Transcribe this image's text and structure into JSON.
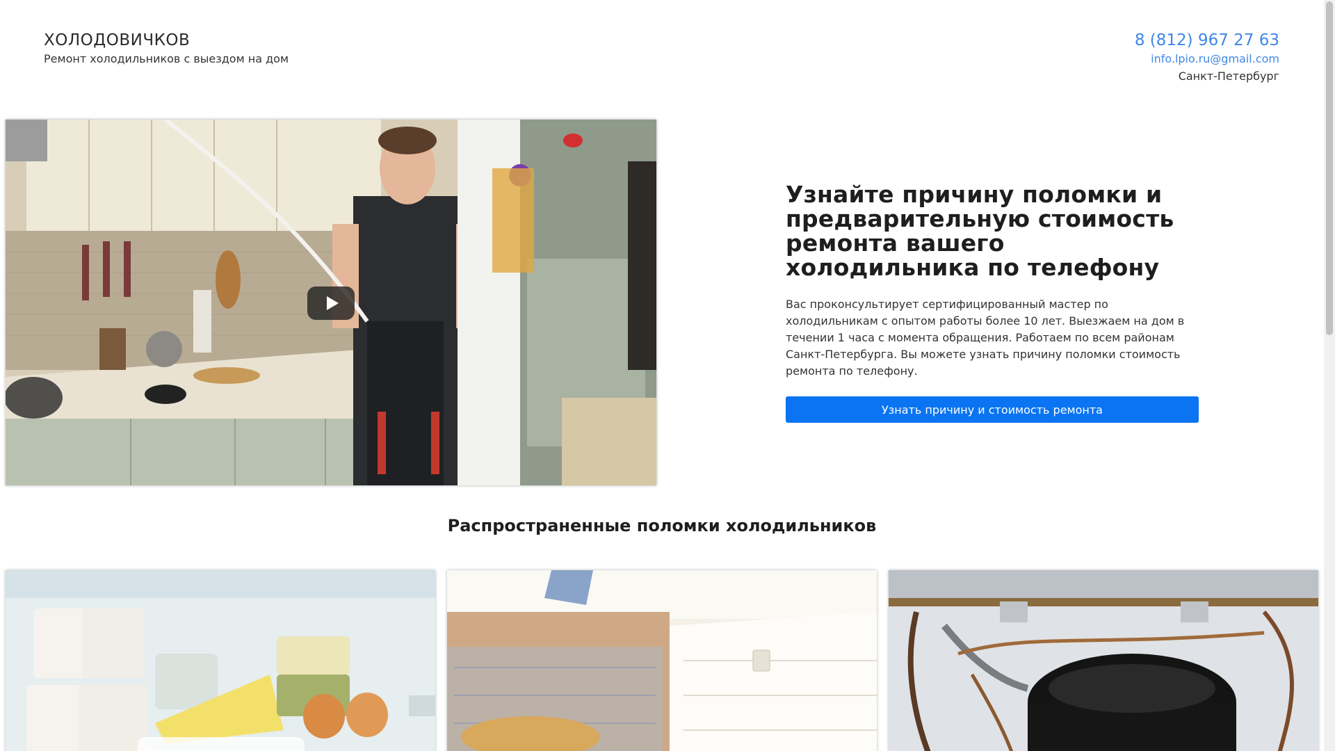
{
  "header": {
    "brand_name": "ХОЛОДОВИЧКОВ",
    "tagline": "Ремонт холодильников с выездом на дом",
    "phone": "8 (812) 967 27 63",
    "email": "info.lpio.ru@gmail.com",
    "city": "Санкт-Петербург"
  },
  "hero": {
    "title": "Узнайте причину поломки и предварительную стоимость ремонта вашего холодильника по телефону",
    "description": "Вас проконсультирует сертифицированный мастер по холодильникам с опытом работы более 10 лет. Выезжаем на дом в течении 1 часа с момента обращения. Работаем по всем районам Санкт-Петербурга. Вы можете узнать причину поломки стоимость ремонта по телефону.",
    "cta_label": "Узнать причину и стоимость ремонта"
  },
  "video": {
    "play_icon": "play-icon"
  },
  "breakdowns": {
    "title": "Распространенные поломки холодильников",
    "cards": [
      {
        "image": "fridge-shelves-photo"
      },
      {
        "image": "freezer-compartment-photo"
      },
      {
        "image": "compressor-photo"
      }
    ]
  },
  "colors": {
    "accent": "#0a74f2",
    "link": "#3f88e6"
  }
}
